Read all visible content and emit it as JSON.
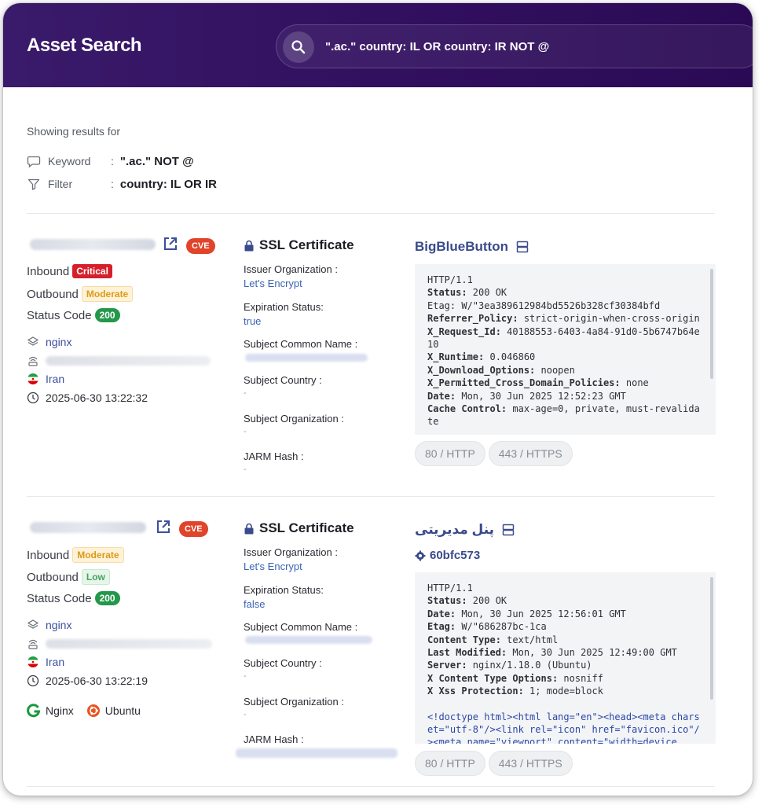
{
  "header": {
    "title": "Asset Search",
    "search_query": "\".ac.\" country: IL OR country: IR NOT @"
  },
  "criteria": {
    "showing_label": "Showing results for",
    "keyword_label": "Keyword",
    "keyword_value": "\".ac.\" NOT @",
    "filter_label": "Filter",
    "filter_value": "country: IL OR IR",
    "colon": ":"
  },
  "colors": {
    "header_bg": "#321060",
    "critical": "#d51f2a",
    "moderate": "#d99b1d",
    "low": "#47a35c",
    "status_ok": "#23984a",
    "cve": "#e0442a",
    "link": "#3b63b5"
  },
  "results": [
    {
      "cve_label": "CVE",
      "inbound_label": "Inbound",
      "inbound_value": "Critical",
      "outbound_label": "Outbound",
      "outbound_value": "Moderate",
      "status_label": "Status Code",
      "status_value": "200",
      "server": "nginx",
      "country": "Iran",
      "timestamp": "2025-06-30 13:22:32",
      "ssl": {
        "title": "SSL Certificate",
        "issuer_label": "Issuer Organization :",
        "issuer_value": "Let's Encrypt",
        "expiration_label": "Expiration Status:",
        "expiration_value": "true",
        "cn_label": "Subject Common Name :",
        "country_label": "Subject Country :",
        "country_value": "-",
        "org_label": "Subject Organization :",
        "org_value": "-",
        "jarm_label": "JARM Hash :",
        "jarm_value": "-"
      },
      "service_title": "BigBlueButton",
      "response": [
        {
          "k": "",
          "v": "HTTP/1.1"
        },
        {
          "k": "Status:",
          "v": " 200 OK"
        },
        {
          "k": "",
          "v": "Etag: W/\"3ea389612984bd5526b328cf30384bfd"
        },
        {
          "k": "Referrer_Policy:",
          "v": " strict-origin-when-cross-origin"
        },
        {
          "k": "X_Request_Id:",
          "v": " 40188553-6403-4a84-91d0-5b6747b64e10"
        },
        {
          "k": "X_Runtime:",
          "v": " 0.046860"
        },
        {
          "k": "X_Download_Options:",
          "v": " noopen"
        },
        {
          "k": "X_Permitted_Cross_Domain_Policies:",
          "v": " none"
        },
        {
          "k": "Date:",
          "v": " Mon, 30 Jun 2025 12:52:23 GMT"
        },
        {
          "k": "Cache Control:",
          "v": " max-age=0, private, must-revalidate"
        }
      ],
      "ports": [
        "80 / HTTP",
        "443 / HTTPS"
      ]
    },
    {
      "cve_label": "CVE",
      "inbound_label": "Inbound",
      "inbound_value": "Moderate",
      "outbound_label": "Outbound",
      "outbound_value": "Low",
      "status_label": "Status Code",
      "status_value": "200",
      "server": "nginx",
      "country": "Iran",
      "timestamp": "2025-06-30 13:22:19",
      "technologies": [
        "Nginx",
        "Ubuntu"
      ],
      "ssl": {
        "title": "SSL Certificate",
        "issuer_label": "Issuer Organization :",
        "issuer_value": "Let's Encrypt",
        "expiration_label": "Expiration Status:",
        "expiration_value": "false",
        "cn_label": "Subject Common Name :",
        "country_label": "Subject Country :",
        "country_value": "-",
        "org_label": "Subject Organization :",
        "org_value": "-",
        "jarm_label": "JARM Hash :"
      },
      "service_title": "پنل مدیریتی",
      "hash": "60bfc573",
      "response": [
        {
          "k": "",
          "v": "HTTP/1.1"
        },
        {
          "k": "Status:",
          "v": " 200 OK"
        },
        {
          "k": "Date:",
          "v": " Mon, 30 Jun 2025 12:56:01 GMT"
        },
        {
          "k": "Etag:",
          "v": " W/\"686287bc-1ca"
        },
        {
          "k": "Content Type:",
          "v": " text/html"
        },
        {
          "k": "Last Modified:",
          "v": " Mon, 30 Jun 2025 12:49:00 GMT"
        },
        {
          "k": "Server:",
          "v": " nginx/1.18.0 (Ubuntu)"
        },
        {
          "k": "X Content Type Options:",
          "v": " nosniff"
        },
        {
          "k": "X Xss Protection:",
          "v": " 1; mode=block"
        }
      ],
      "html_snippet": "<!doctype html><html lang=\"en\"><head><meta charset=\"utf-8\"/><link rel=\"icon\" href=\"favicon.ico\"/><meta name=\"viewport\" content=\"width=device",
      "ports": [
        "80 / HTTP",
        "443 / HTTPS"
      ]
    }
  ]
}
